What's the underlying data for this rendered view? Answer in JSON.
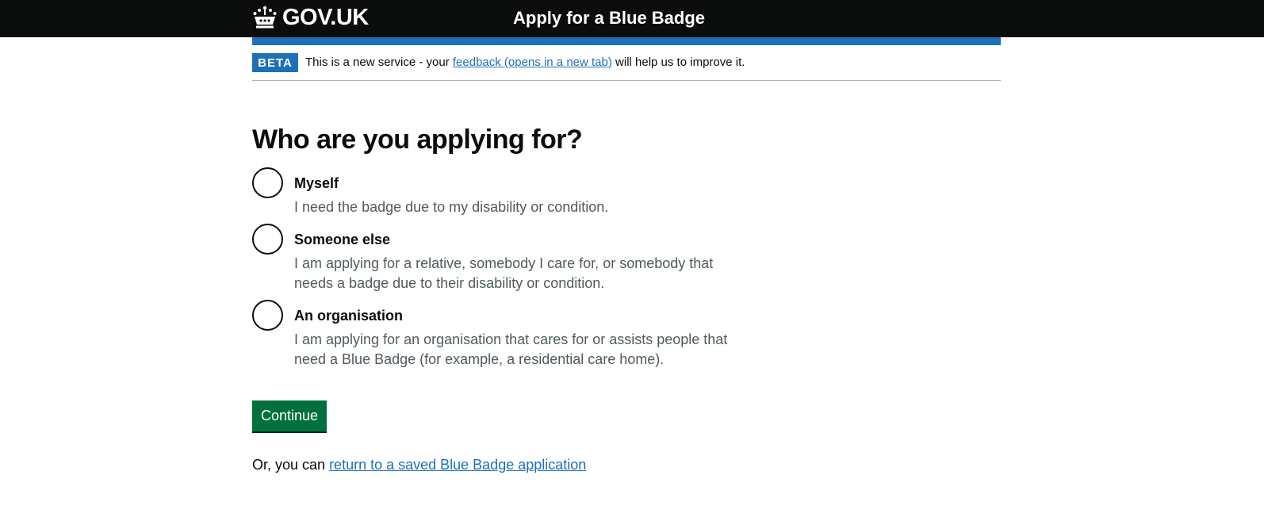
{
  "header": {
    "logo_text": "GOV.UK",
    "service_name": "Apply for a Blue Badge"
  },
  "phase_banner": {
    "tag": "BETA",
    "text_before": "This is a new service - your ",
    "link_text": "feedback (opens in a new tab)",
    "text_after": " will help us to improve it."
  },
  "question": {
    "title": "Who are you applying for?",
    "options": [
      {
        "label": "Myself",
        "hint": "I need the badge due to my disability or condition.",
        "selected": false
      },
      {
        "label": "Someone else",
        "hint": "I am applying for a relative, somebody I care for, or somebody that needs a badge due to their disability or condition.",
        "selected": false
      },
      {
        "label": "An organisation",
        "hint": "I am applying for an organisation that cares for or assists people that need a Blue Badge (for example, a residential care home).",
        "selected": false
      }
    ]
  },
  "actions": {
    "continue_label": "Continue",
    "return_prefix": "Or, you can ",
    "return_link": "return to a saved Blue Badge application"
  },
  "colors": {
    "header_bg": "#0b0c0c",
    "brand_blue": "#1d70b8",
    "button_green": "#00703c",
    "hint_grey": "#505a5f"
  }
}
